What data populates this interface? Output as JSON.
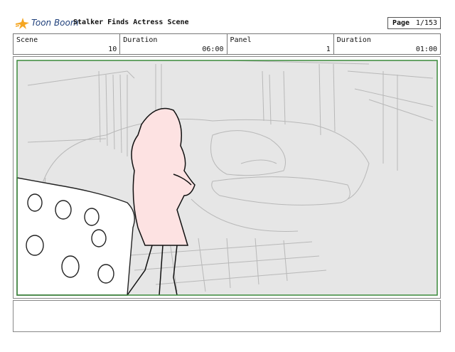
{
  "header": {
    "logo_text": "Toon Boom",
    "title": "Stalker Finds Actress Scene",
    "page_label": "Page",
    "page_value": "1/153"
  },
  "info": {
    "scene_label": "Scene",
    "scene_value": "10",
    "scene_duration_label": "Duration",
    "scene_duration_value": "06:00",
    "panel_label": "Panel",
    "panel_value": "1",
    "panel_duration_label": "Duration",
    "panel_duration_value": "01:00"
  },
  "colors": {
    "frame_green": "#3a8a3a",
    "sketch_bg": "#e6e6e6",
    "character_fill": "#fde2e2",
    "logo_blue": "#1e3f7a",
    "logo_star": "#f5a623"
  }
}
